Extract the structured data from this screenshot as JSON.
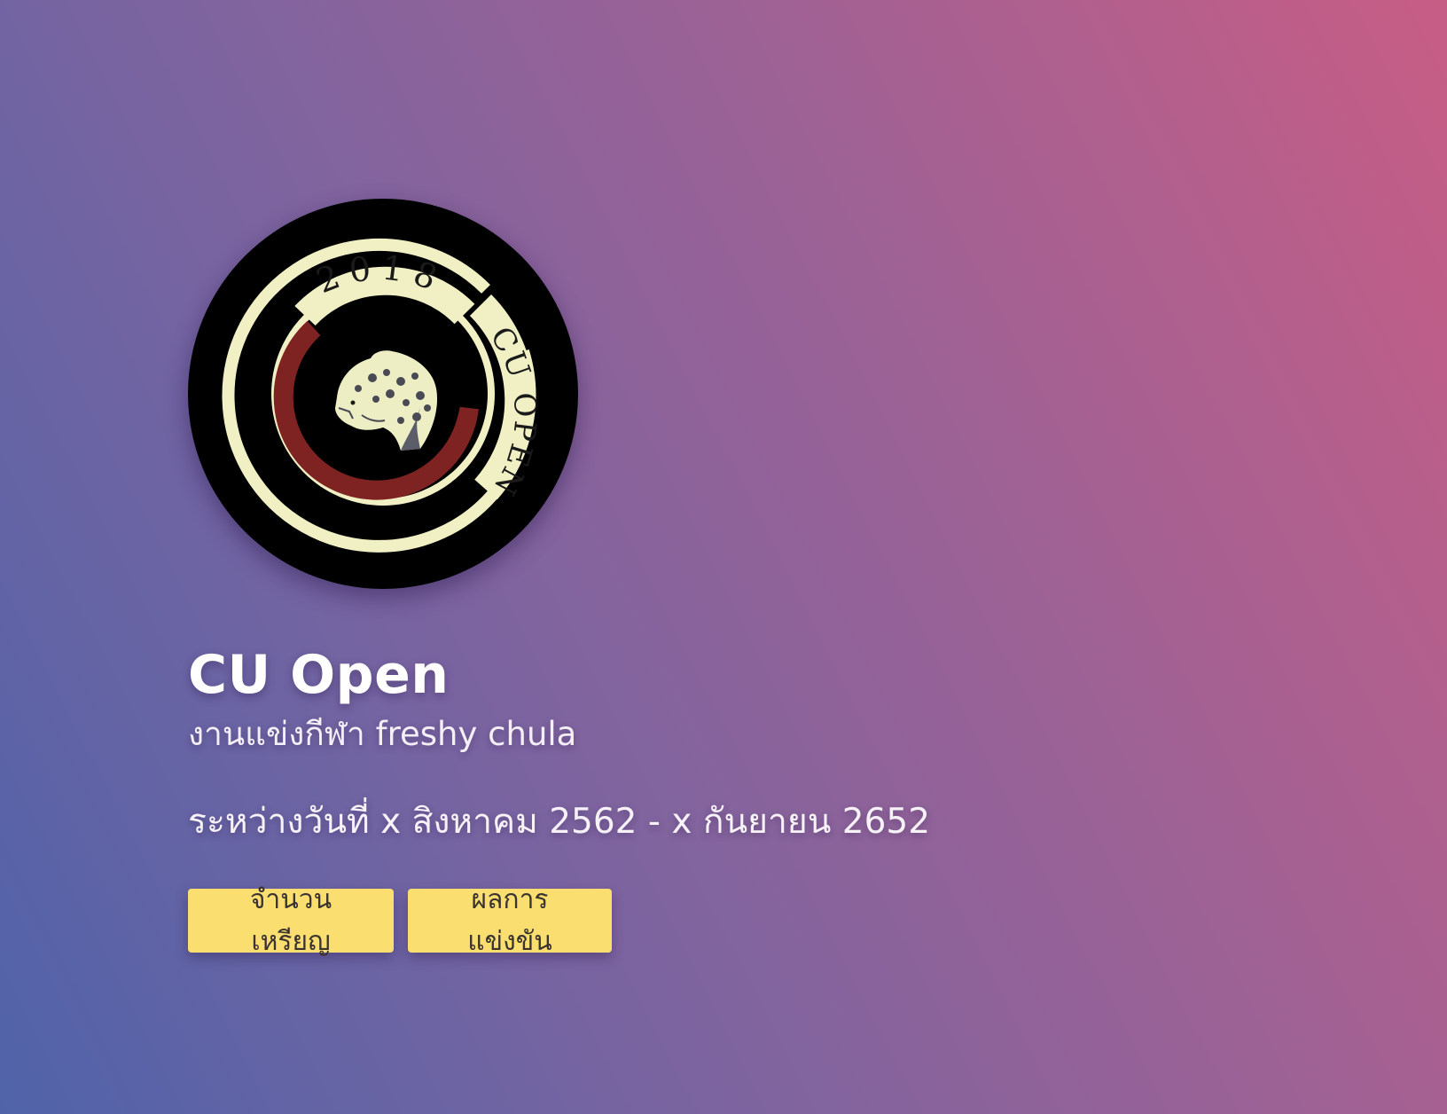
{
  "hero": {
    "logo": {
      "icon": "leopard-emblem-icon",
      "year_text": "2018",
      "ring_text": "CU OPEN",
      "colors": {
        "outer": "#000000",
        "ring": "#f1f0c4",
        "accent": "#7f2322",
        "leopard": "#eeeec5"
      }
    },
    "title": "CU Open",
    "subtitle": "งานแข่งกีฬา freshy chula",
    "dates": "ระหว่างวันที่ x สิงหาคม 2562 - x กันยายน 2652",
    "buttons": {
      "medals_label": "จำนวนเหรียญ",
      "results_label": "ผลการแข่งขัน"
    }
  },
  "theme": {
    "gradient": [
      "#5063a9",
      "#9a6296",
      "#c75d85"
    ],
    "button_color": "#fadf70",
    "button_text_color": "#3a3330"
  }
}
